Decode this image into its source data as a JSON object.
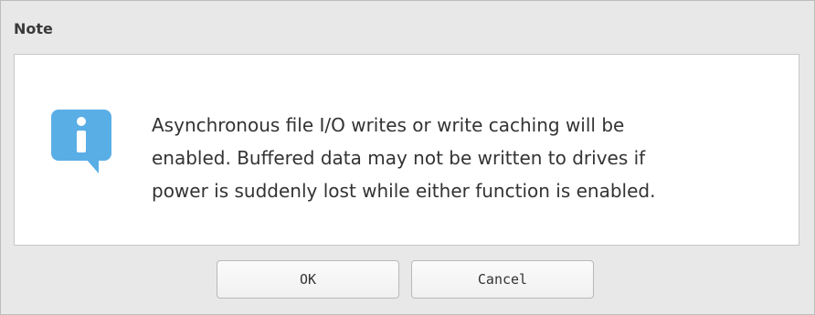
{
  "dialog": {
    "title": "Note",
    "message_lines": [
      "Asynchronous file I/O writes or write caching will be",
      "enabled. Buffered data may not be written to drives if",
      "power is suddenly lost while either function is enabled."
    ],
    "icon": "info-icon",
    "ok_label": "OK",
    "cancel_label": "Cancel"
  },
  "colors": {
    "icon_blue": "#5aaee6",
    "chrome_bg": "#e8e8e8",
    "body_bg": "#ffffff"
  }
}
